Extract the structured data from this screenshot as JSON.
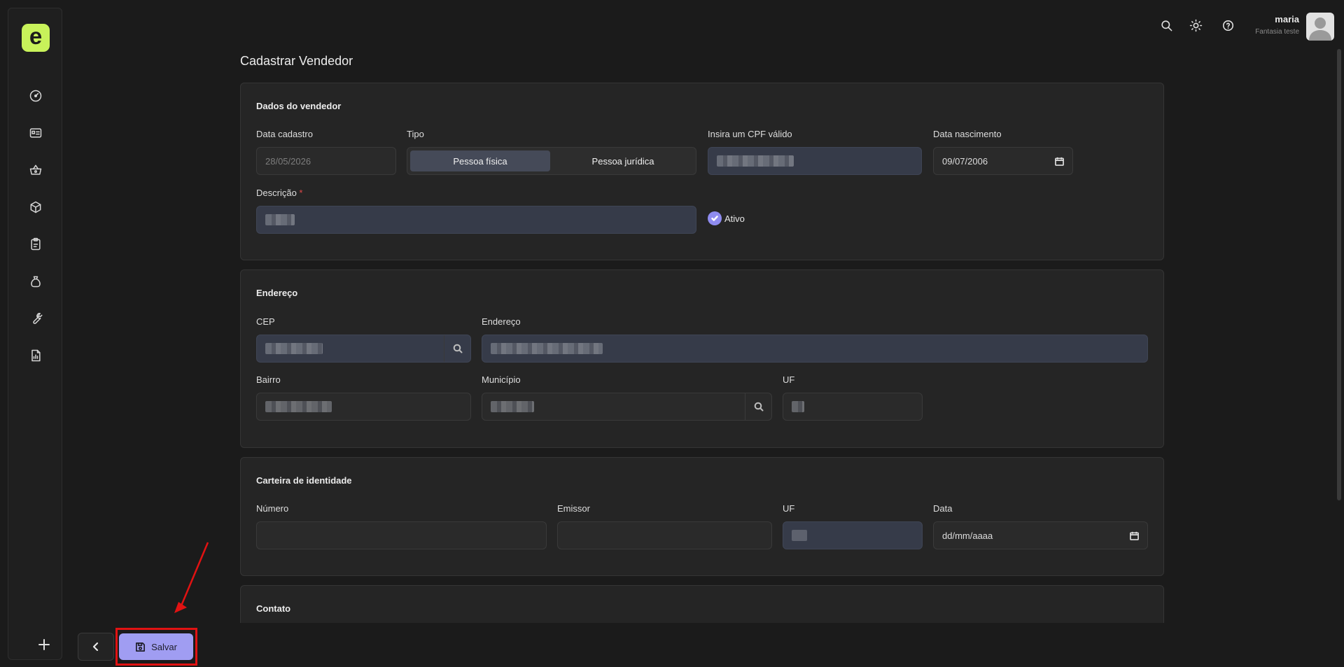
{
  "brand": {
    "logo_letter": "e",
    "accent": "#c8f25a"
  },
  "sidebar": {
    "items": [
      {
        "icon": "dashboard-gauge-icon"
      },
      {
        "icon": "id-card-icon"
      },
      {
        "icon": "shopping-basket-icon"
      },
      {
        "icon": "box-icon"
      },
      {
        "icon": "clipboard-icon"
      },
      {
        "icon": "money-bag-icon"
      },
      {
        "icon": "wrench-icon"
      },
      {
        "icon": "report-icon"
      }
    ],
    "add_icon": "plus-icon"
  },
  "header": {
    "icons": [
      "search-icon",
      "sun-icon",
      "help-icon"
    ],
    "user": {
      "name": "maria",
      "company": "Fantasia teste"
    }
  },
  "page": {
    "title": "Cadastrar Vendedor"
  },
  "dados_vendedor": {
    "title": "Dados do vendedor",
    "data_cadastro": {
      "label": "Data cadastro",
      "value": "28/05/2026"
    },
    "tipo": {
      "label": "Tipo",
      "options": [
        "Pessoa física",
        "Pessoa jurídica"
      ],
      "selected": "Pessoa física"
    },
    "cpf": {
      "label": "Insira um CPF válido"
    },
    "data_nascimento": {
      "label": "Data nascimento",
      "value": "09/07/2006"
    },
    "descricao": {
      "label": "Descrição",
      "required_mark": "*"
    },
    "ativo": {
      "label": "Ativo",
      "checked": true
    }
  },
  "endereco": {
    "title": "Endereço",
    "cep": {
      "label": "CEP"
    },
    "endereco": {
      "label": "Endereço"
    },
    "bairro": {
      "label": "Bairro"
    },
    "municipio": {
      "label": "Município"
    },
    "uf": {
      "label": "UF"
    }
  },
  "carteira": {
    "title": "Carteira de identidade",
    "numero": {
      "label": "Número"
    },
    "emissor": {
      "label": "Emissor"
    },
    "uf": {
      "label": "UF"
    },
    "data": {
      "label": "Data",
      "placeholder": "dd/mm/aaaa"
    }
  },
  "contato": {
    "title": "Contato"
  },
  "footer": {
    "save_label": "Salvar",
    "save_color": "#a09df2"
  }
}
